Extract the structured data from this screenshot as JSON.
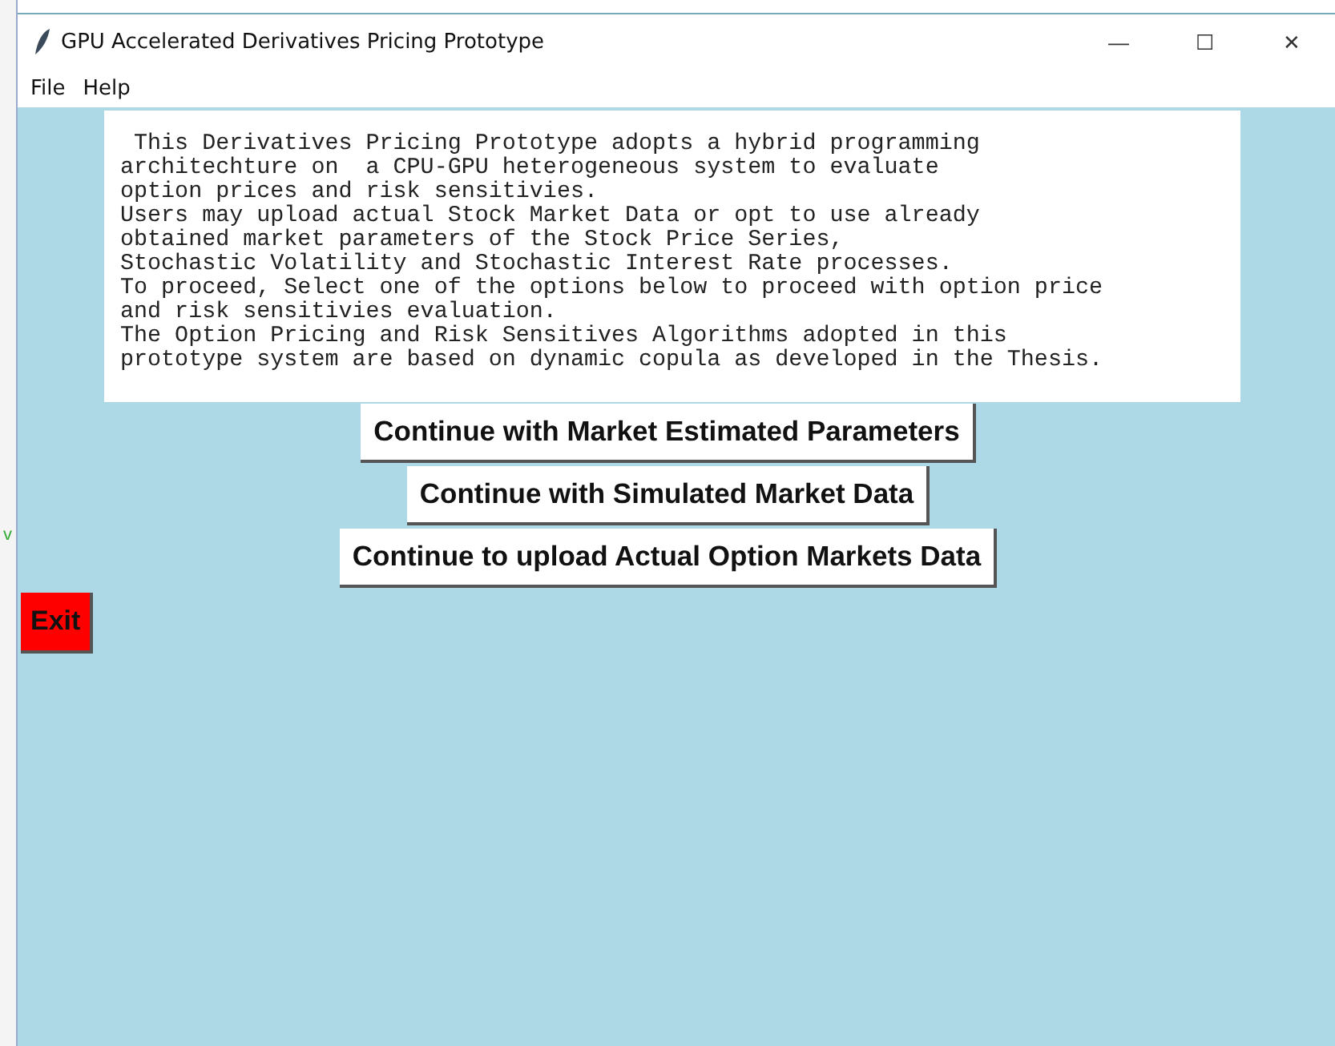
{
  "window": {
    "title": "GPU Accelerated Derivatives Pricing Prototype",
    "controls": [
      "—",
      "☐",
      "✕"
    ]
  },
  "menu": [
    "File",
    "Help"
  ],
  "desktop_mark": "v",
  "description": [
    " This Derivatives Pricing Prototype adopts a hybrid programming",
    "architechture on  a CPU-GPU heterogeneous system to evaluate",
    "option prices and risk sensitivies.",
    "Users may upload actual Stock Market Data or opt to use already",
    "obtained market parameters of the Stock Price Series,",
    "Stochastic Volatility and Stochastic Interest Rate processes.",
    "To proceed, Select one of the options below to proceed with option price",
    "and risk sensitivies evaluation.",
    "The Option Pricing and Risk Sensitives Algorithms adopted in this",
    "prototype system are based on dynamic copula as developed in the Thesis."
  ],
  "buttons": [
    {
      "label": "Continue with Market Estimated Parameters",
      "kind": "action"
    },
    {
      "label": "Continue with Simulated Market Data",
      "kind": "action"
    },
    {
      "label": "Continue to upload Actual Option Markets Data",
      "kind": "action"
    },
    {
      "label": "Exit",
      "kind": "exit"
    }
  ]
}
